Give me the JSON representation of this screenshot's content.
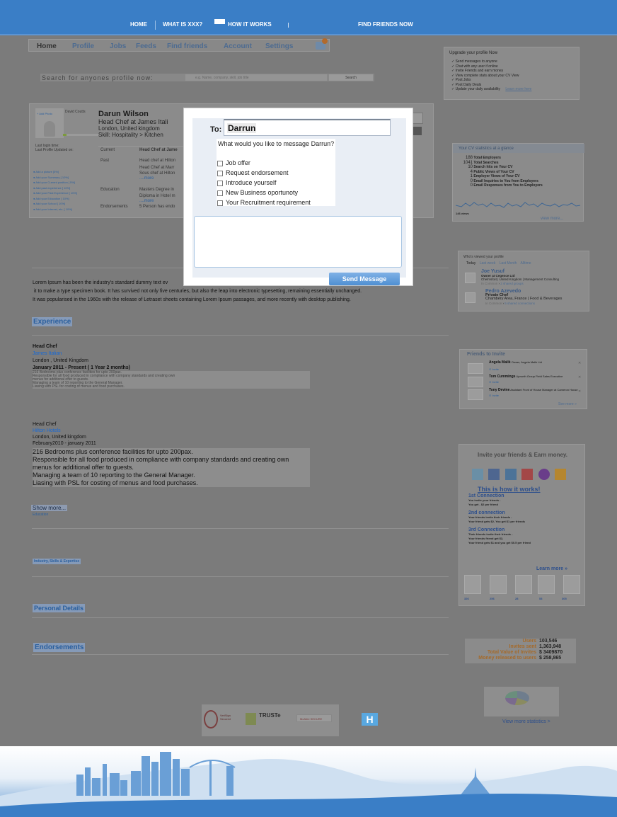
{
  "nav": {
    "home": "HOME",
    "what_is": "WHAT IS XXX?",
    "how_it_works": "HOW IT WORKS",
    "find_friends": "FIND FRIENDS NOW"
  },
  "tabs": [
    "Home",
    "Profile",
    "Jobs",
    "Feeds",
    "Find friends",
    "Account",
    "Settings"
  ],
  "search": {
    "label": "Search for anyones profile now:",
    "placeholder": "e.g. Name, company, skill, job title",
    "button": "Search"
  },
  "profile": {
    "name": "Darun Wilson",
    "title": "Head Chef at James Itali",
    "location": "London, United kingdom",
    "skill": "Skill: Hospitality > Kitchen",
    "avatar_caption": "David Coutts",
    "add_photo": "+ Add Photo",
    "last_login": "Last login time:",
    "last_updated": "Last Profile Updated on:",
    "side_links": [
      "Add a picture [5%]",
      "Add your Summary [ 10%]",
      "Add your Current position [ 5%]",
      "Add past experience [ 10%]",
      "Add your Past Experience [ 10%]",
      "Add your Education [ 10%]",
      "Add your School [ 10%]",
      "Add your Interest, etc. [ 10%]"
    ],
    "rows": [
      {
        "label": "Current",
        "value": "Head Chef at Jame"
      },
      {
        "label": "Past",
        "value": "Head chef at Hilton"
      },
      {
        "label": "",
        "value": "Head Chef at Marr"
      },
      {
        "label": "",
        "value": "Sous chef at Hilton"
      },
      {
        "label": "",
        "value": "....more"
      },
      {
        "label": "Education",
        "value": "Masters Degree in"
      },
      {
        "label": "",
        "value": "Diploma in Hotel m"
      },
      {
        "label": "",
        "value": "....more"
      },
      {
        "label": "Endorsements",
        "value": "5 Person has endo"
      }
    ]
  },
  "modal": {
    "to_label": "To:",
    "to_value": "Darrun",
    "question": "What would you like to message Darrun?",
    "options": [
      "Job offer",
      "Request endorsement",
      "Introduce yourself",
      "New Business oportunoty",
      "Your Recruitment requirement"
    ],
    "send": "Send Message"
  },
  "summary": [
    "Lorem Ipsum has been the industry's standard dummy text ev",
    "it to make a type specimen book. It has survived not only five centuries, but also the leap into electronic typesetting, remaining essentially unchanged.",
    "It was popularised in the 1960s with the release of Letraset sheets containing Lorem Ipsum passages, and more recently with desktop publishing."
  ],
  "experience": {
    "heading": "Experience",
    "jobs": [
      {
        "title": "Head Chef",
        "company": "James Italian",
        "location": "London , United Kingdom",
        "dates": "January 2011 - Present ( 1 Year 2 months)",
        "lines": [
          "216 Bedrooms plus conference facilities for upto 200pax.",
          "Responsible for all food produced in compliance with company standards and creating own",
          "menus for additional offer to guests.",
          "Managing a team of 10 reporting to the General Manager.",
          "Liasing with PSL for costing of menus and food purchases."
        ]
      },
      {
        "title": "Head Chef",
        "company": "Hilton Hotels",
        "location": "London, United kingdom",
        "dates": "February2010 - january 2011",
        "lines": [
          "216 Bedrooms plus conference facilities for upto 200pax.",
          "Responsible for all food produced in compliance with company standards and creating own",
          "menus for additional offer to guests.",
          "Managing a team of 10 reporting to the General Manager.",
          "Liasing with PSL for costing of menus and food purchases."
        ]
      }
    ],
    "show_more": "Show more...",
    "education_cut": "Education"
  },
  "sections": {
    "industry": "Industry, Skills & Expertise",
    "personal": "Personal Details",
    "endorsements": "Endorsements"
  },
  "upgrade": {
    "title": "Upgrade your profile Now",
    "items": [
      "Send messages to anyone",
      "Chat with any user if online",
      "Invite Friends and earn money",
      "View complete stats about your CV View",
      "Post Jobs",
      "Post Daily Deals",
      "Update your daily availability"
    ],
    "link": "Learn more here"
  },
  "cv_stats": {
    "title": "Your CV statistics at a glance",
    "rows": [
      {
        "n": "188",
        "label": "Total Employers"
      },
      {
        "n": "1041",
        "label": "Total Searches"
      },
      {
        "n": "10",
        "label": "Search hits on Your CV"
      },
      {
        "n": "4",
        "label": "Public Views of Your CV"
      },
      {
        "n": "1",
        "label": "Employer Views of Your CV"
      },
      {
        "n": "0",
        "label": "Email Inquiries to You from Employers"
      },
      {
        "n": "0",
        "label": "Email Responses from You to Employers"
      }
    ],
    "graph_label": "146 views",
    "link": "view more..."
  },
  "viewed": {
    "title": "Who's viewed your profile",
    "filters": [
      "Today",
      "Last week",
      "Last Month",
      "Alltime"
    ],
    "people": [
      {
        "name": "Joe Yusuf",
        "role": "Owner at Cegence Ltd",
        "loc": "Chelmsford, United Kingdom | Management Consulting",
        "meta": "In Common",
        "shared": "2 shared groups"
      },
      {
        "name": "Pedro Azevedo",
        "role": "Private Chef",
        "loc": "Chambéry Area, France | Food & Beverages",
        "meta": "In Common",
        "shared": "5 shared connections"
      }
    ]
  },
  "friends_invite": {
    "title": "Friends to Invite",
    "people": [
      {
        "name": "Angela Malik",
        "role": "Owner, Angela Malik Ltd"
      },
      {
        "name": "Tom Cummings",
        "role": "Upnorth Group Field Sales Executive"
      },
      {
        "name": "Tony Devine",
        "role": "Assistant Front of House Manager at Cameron House"
      }
    ],
    "invite": "Invite",
    "see_more": "See more »"
  },
  "earn": {
    "title": "Invite your friends & Earn money.",
    "how": "This is how it works!",
    "c1_title": "1st Connection",
    "c1_lines": [
      "You invite your friends -",
      "You get - $2 per friend"
    ],
    "c2_title": "2nd connection",
    "c2_lines": [
      "Your friends invite their friends -",
      "Your friend gets $2- You get $1 per friends"
    ],
    "c3_title": "3rd Connection",
    "c3_lines": [
      "Their friends invite their friends -",
      "Your friends friend get $2,",
      "Your friend gets $1 and you get $0.5 per friend"
    ],
    "learn_more": "Learn more »",
    "counts": [
      "326",
      "256",
      "28",
      "53",
      "305"
    ]
  },
  "site_stats": [
    {
      "label": "Users",
      "value": "103,546"
    },
    {
      "label": "Invites sent",
      "value": "1,363,948"
    },
    {
      "label": "Total Value of Invites",
      "value": "$ 3409870"
    },
    {
      "label": "Money released to users",
      "value": "$ 258,865"
    }
  ],
  "view_stats_link": "View more statistics >",
  "trust": {
    "verisign": "VeriSign Secured",
    "truste": "TRUSTe",
    "mcafee": "McAfee SECURE",
    "h": "H"
  },
  "colors": {
    "topbar": "#3a7ec6",
    "accent_blue": "#1769d6",
    "orange": "#d9822b"
  }
}
